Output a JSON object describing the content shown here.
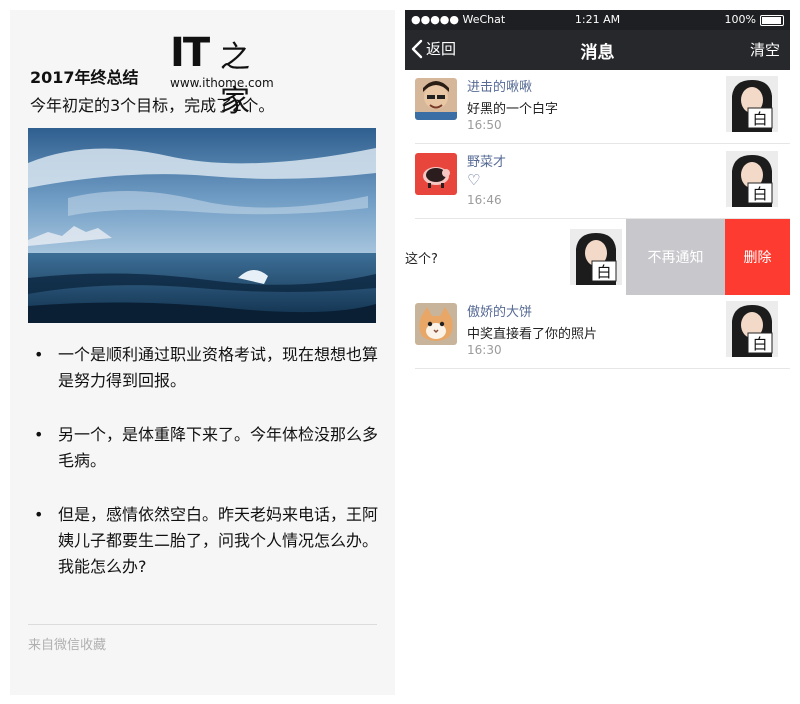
{
  "note": {
    "logo_text": "IT之家",
    "logo_url": "www.ithome.com",
    "title": "2017年终总结",
    "subtitle": "今年初定的3个目标，完成了2个。",
    "bullets": [
      "一个是顺利通过职业资格考试，现在想想也算是努力得到回报。",
      "另一个，是体重降下来了。今年体检没那么多毛病。",
      "但是，感情依然空白。昨天老妈来电话，王阿姨儿子都要生二胎了，问我个人情况怎么办。我能怎么办?"
    ],
    "source": "来自微信收藏"
  },
  "status_bar": {
    "carrier": "●●●●● WeChat",
    "time": "1:21 AM",
    "battery": "100%"
  },
  "nav": {
    "back_label": "返回",
    "title": "消息",
    "clear_label": "清空"
  },
  "messages": [
    {
      "name": "进击的啾啾",
      "text": "好黑的一个白字",
      "time": "16:50"
    },
    {
      "name": "野菜才",
      "text": "♡",
      "time": "16:46"
    },
    {
      "name": "",
      "text": "这个?",
      "time": ""
    },
    {
      "name": "傲娇的大饼",
      "text": "中奖直接看了你的照片",
      "time": "16:30"
    }
  ],
  "swipe_actions": {
    "mute_label": "不再通知",
    "delete_label": "删除"
  },
  "thumbnail_character": "白",
  "colors": {
    "navbar": "#27282b",
    "name_link": "#576b95",
    "delete": "#fe3b30",
    "mute": "#c7c7cc"
  }
}
